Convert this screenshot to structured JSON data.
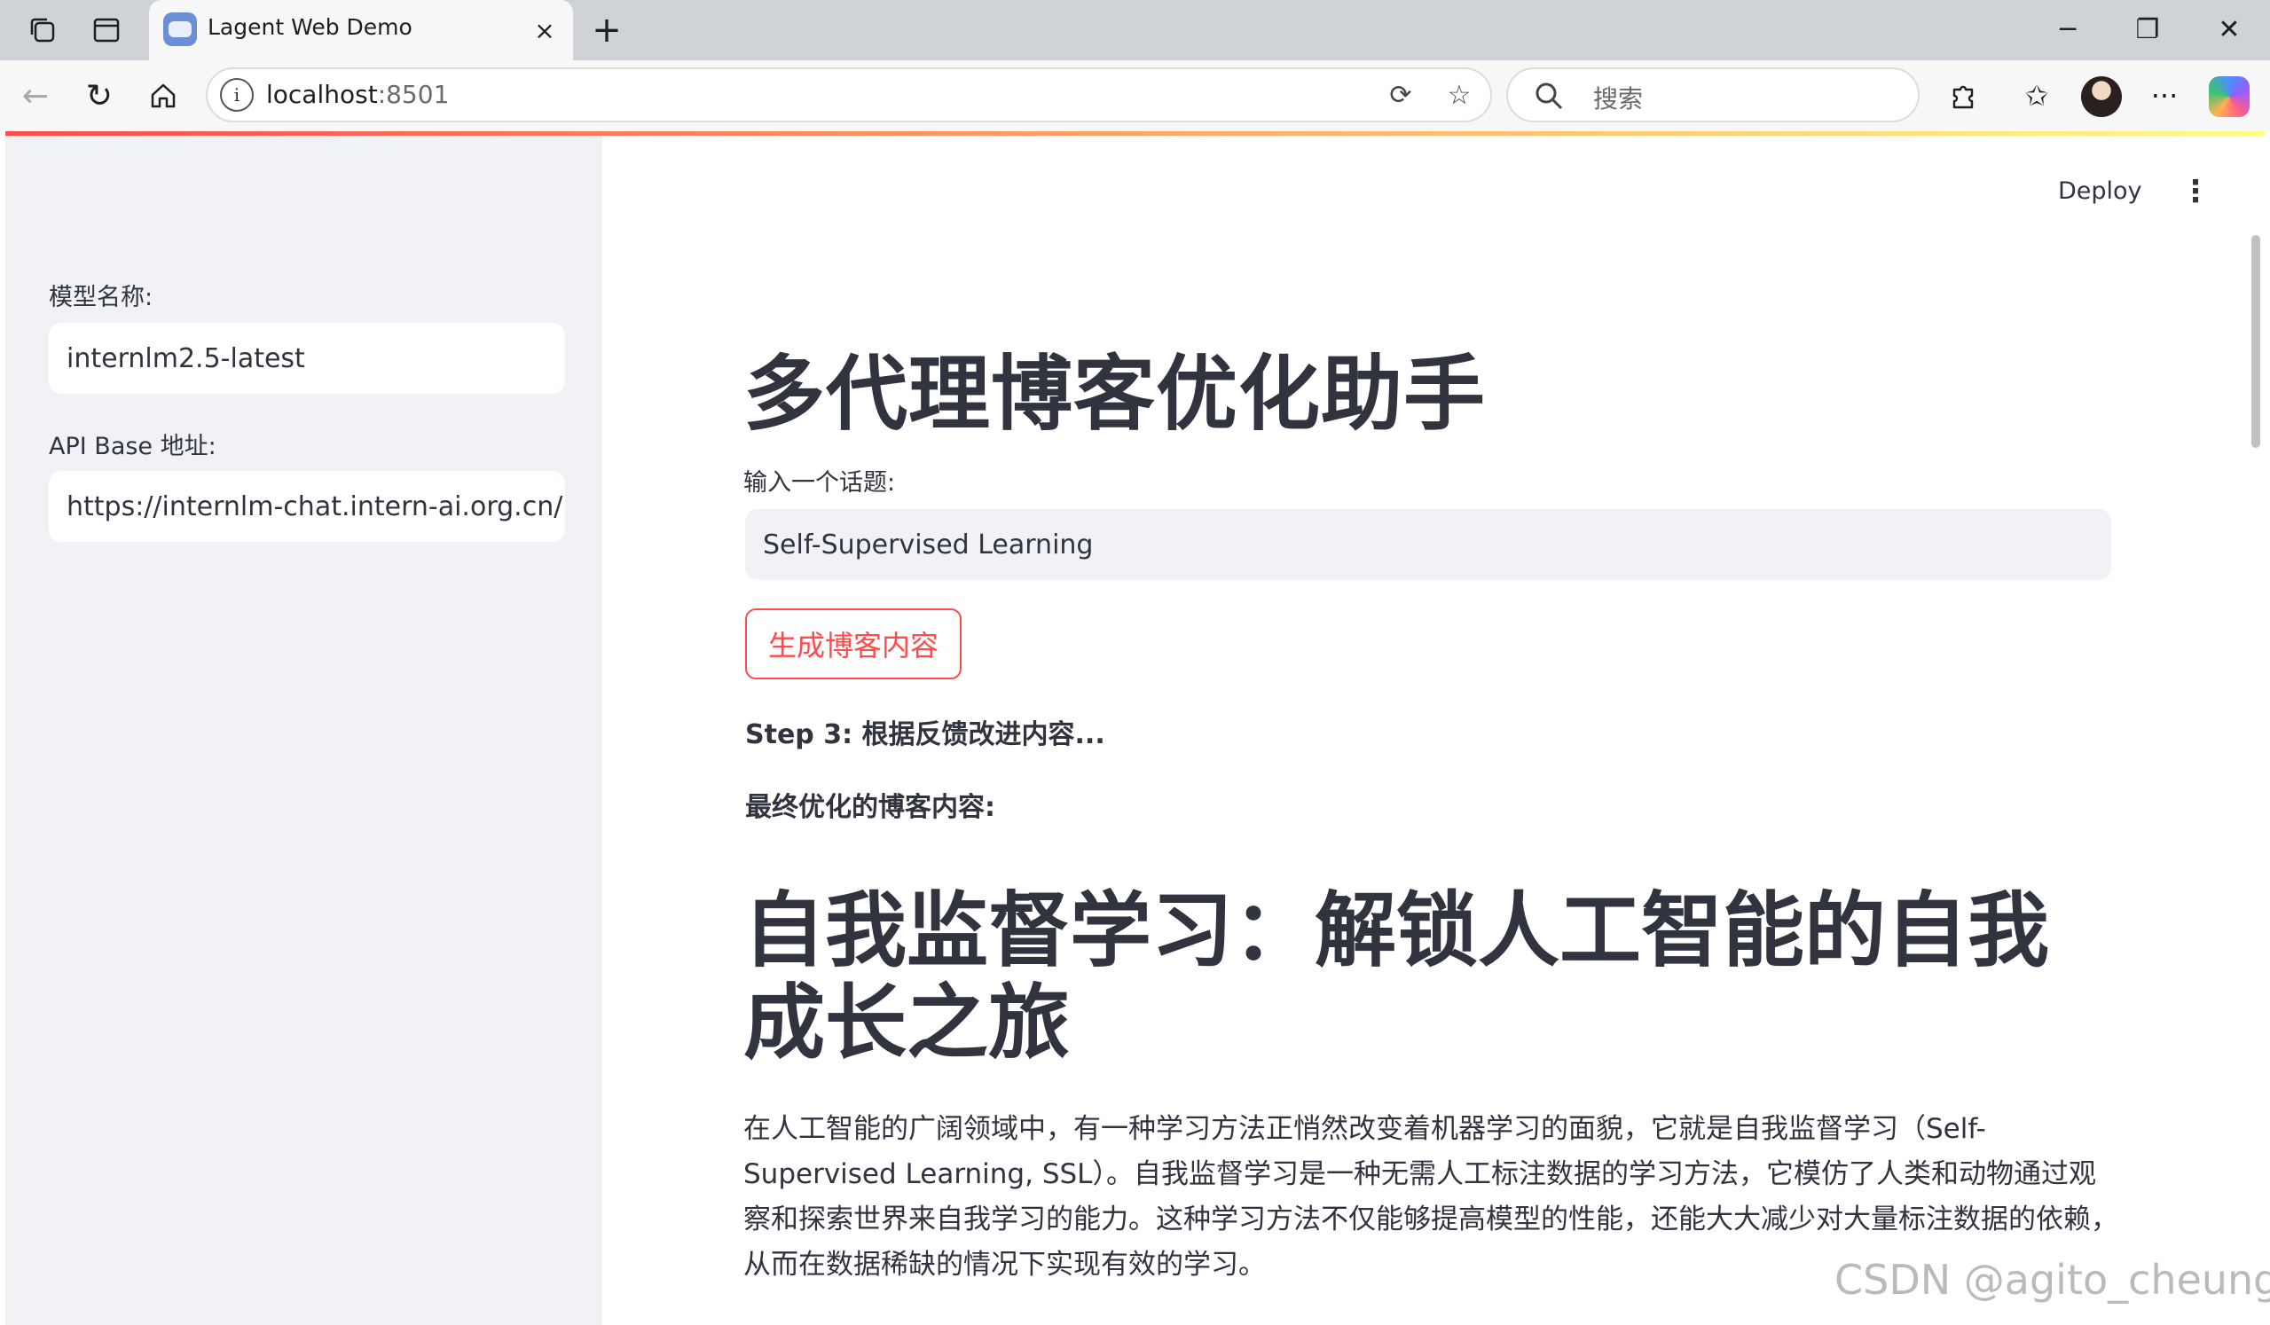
{
  "browser": {
    "tab": {
      "title": "Lagent Web Demo",
      "close_icon": "×"
    },
    "new_tab_label": "+",
    "window_controls": {
      "minimize": "─",
      "restore": "❐",
      "close": "✕"
    },
    "address": {
      "host": "localhost",
      "port": ":8501"
    },
    "search": {
      "placeholder": "搜索"
    }
  },
  "sidebar": {
    "model_label": "模型名称:",
    "model_value": "internlm2.5-latest",
    "api_label": "API Base 地址:",
    "api_value": "https://internlm-chat.intern-ai.org.cn/pu"
  },
  "header": {
    "deploy_label": "Deploy",
    "menu_icon": "⋮"
  },
  "main": {
    "title": "多代理博客优化助手",
    "topic_label": "输入一个话题:",
    "topic_value": "Self-Supervised Learning",
    "generate_button": "生成博客内容",
    "step_text": "Step 3: 根据反馈改进内容...",
    "final_label": "最终优化的博客内容:",
    "blog_title": "自我监督学习：解锁人工智能的自我成长之旅",
    "blog_paragraph": "在人工智能的广阔领域中，有一种学习方法正悄然改变着机器学习的面貌，它就是自我监督学习（Self-Supervised Learning, SSL）。自我监督学习是一种无需人工标注数据的学习方法，它模仿了人类和动物通过观察和探索世界来自我学习的能力。这种学习方法不仅能够提高模型的性能，还能大大减少对大量标注数据的依赖，从而在数据稀缺的情况下实现有效的学习。"
  },
  "watermark": "CSDN @agito_cheung",
  "colors": {
    "accent": "#ff4b4b",
    "sidebar_bg": "#f0f2f6",
    "text": "#31333f"
  }
}
